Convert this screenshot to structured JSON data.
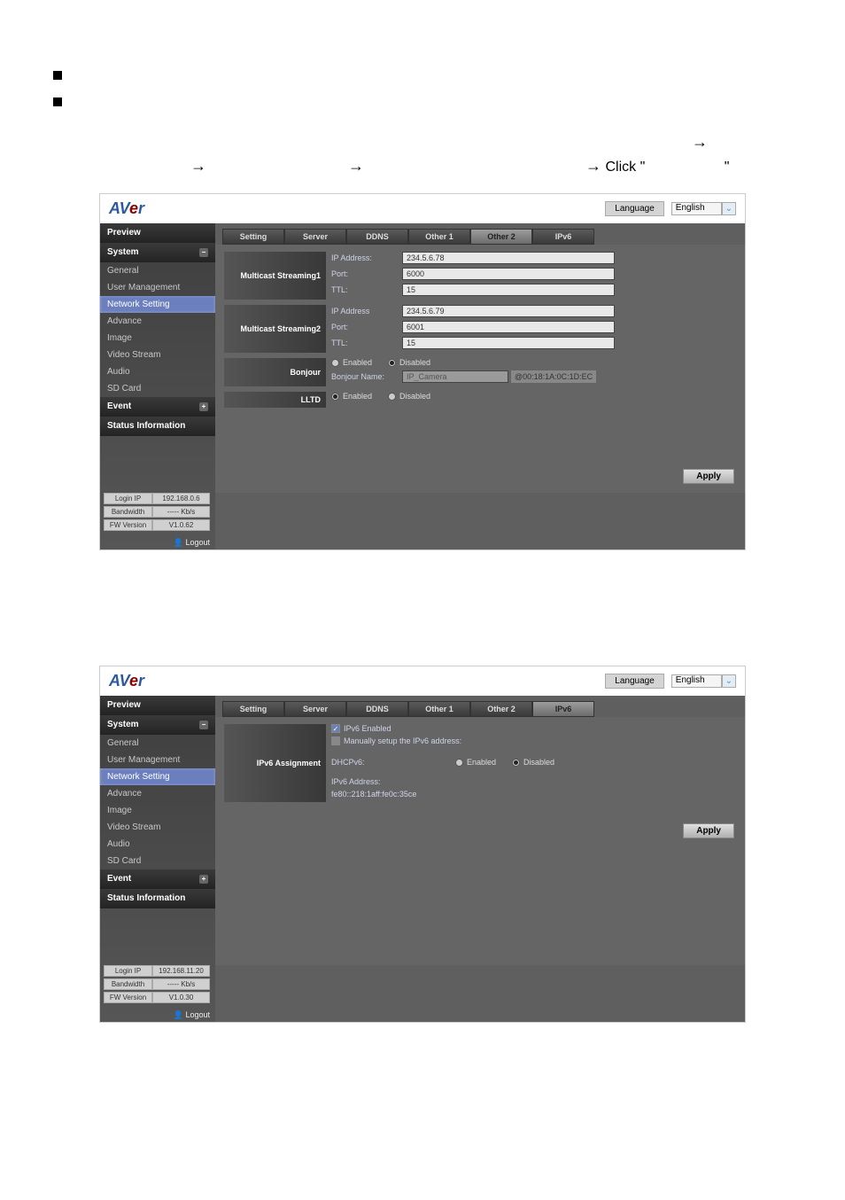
{
  "common": {
    "language_label": "Language",
    "language_value": "English",
    "apply_label": "Apply",
    "logout_label": "Logout",
    "click_text": " Click \""
  },
  "sidebar": {
    "preview": "Preview",
    "system": "System",
    "items": [
      "General",
      "User Management",
      "Network Setting",
      "Advance",
      "Image",
      "Video Stream",
      "Audio",
      "SD Card"
    ],
    "event": "Event",
    "status_info": "Status Information"
  },
  "tabs": {
    "setting": "Setting",
    "server": "Server",
    "ddns": "DDNS",
    "other1": "Other 1",
    "other2": "Other 2",
    "ipv6": "IPv6"
  },
  "panel1": {
    "status": {
      "login_ip_label": "Login IP",
      "login_ip_value": "192.168.0.6",
      "bandwidth_label": "Bandwidth",
      "bandwidth_value": "----- Kb/s",
      "fw_label": "FW Version",
      "fw_value": "V1.0.62"
    },
    "mc1_label": "Multicast Streaming1",
    "mc2_label": "Multicast Streaming2",
    "ip_label": "IP Address:",
    "ip_label2": "IP Address",
    "port_label": "Port:",
    "ttl_label": "TTL:",
    "mc1_ip": "234.5.6.78",
    "mc1_port": "6000",
    "mc1_ttl": "15",
    "mc2_ip": "234.5.6.79",
    "mc2_port": "6001",
    "mc2_ttl": "15",
    "bonjour_label": "Bonjour",
    "bonjour_name_label": "Bonjour Name:",
    "bonjour_name_value": "IP_Camera",
    "bonjour_suffix": "@00:18:1A:0C:1D:EC",
    "lltd_label": "LLTD",
    "enabled": "Enabled",
    "disabled": "Disabled"
  },
  "panel2": {
    "status": {
      "login_ip_label": "Login IP",
      "login_ip_value": "192.168.11.20",
      "bandwidth_label": "Bandwidth",
      "bandwidth_value": "----- Kb/s",
      "fw_label": "FW Version",
      "fw_value": "V1.0.30"
    },
    "section_label": "IPv6 Assignment",
    "ipv6_enabled": "IPv6 Enabled",
    "manual_setup": "Manually setup the IPv6 address:",
    "dhcpv6_label": "DHCPv6:",
    "enabled": "Enabled",
    "disabled": "Disabled",
    "ipv6_addr_label": "IPv6 Address:",
    "ipv6_addr_value": "fe80::218:1aff:fe0c:35ce"
  }
}
